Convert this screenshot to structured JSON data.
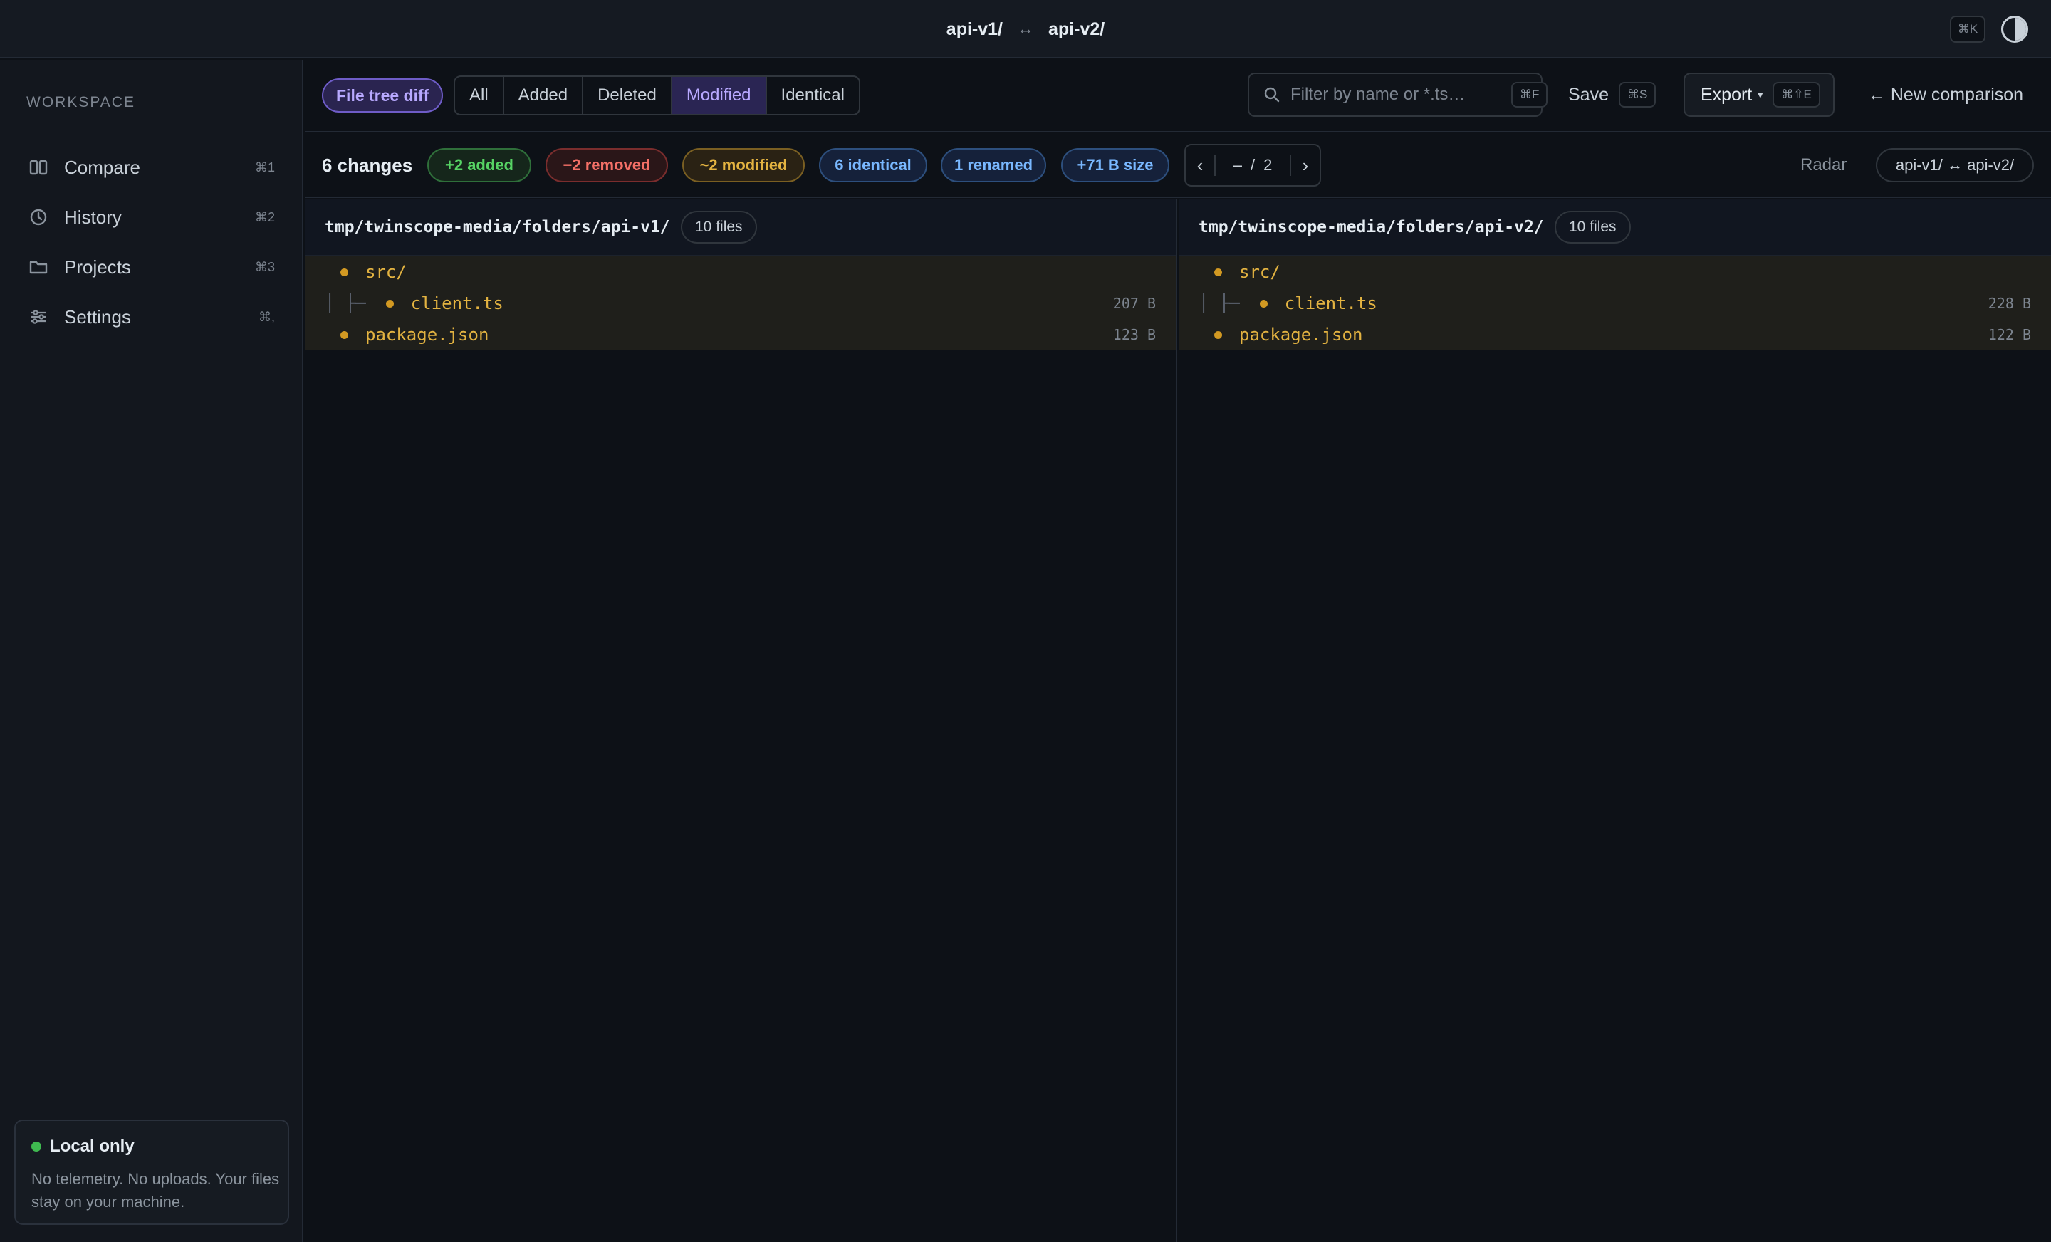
{
  "titlebar": {
    "left_name": "api-v1/",
    "arrow": "↔",
    "right_name": "api-v2/",
    "shortcut": "⌘K"
  },
  "sidebar": {
    "section_label": "WORKSPACE",
    "items": [
      {
        "label": "Compare",
        "shortcut": "⌘1",
        "icon": "columns-icon"
      },
      {
        "label": "History",
        "shortcut": "⌘2",
        "icon": "clock-icon"
      },
      {
        "label": "Projects",
        "shortcut": "⌘3",
        "icon": "folder-icon"
      },
      {
        "label": "Settings",
        "shortcut": "⌘,",
        "icon": "sliders-icon"
      }
    ],
    "privacy": {
      "title": "Local only",
      "text": "No telemetry. No uploads. Your files stay on your machine."
    }
  },
  "toolbar": {
    "view_pill": "File tree diff",
    "filters": [
      {
        "label": "All",
        "active": false
      },
      {
        "label": "Added",
        "active": false
      },
      {
        "label": "Deleted",
        "active": false
      },
      {
        "label": "Modified",
        "active": true
      },
      {
        "label": "Identical",
        "active": false
      }
    ],
    "search": {
      "placeholder": "Filter by name or *.ts…",
      "value": "",
      "shortcut": "⌘F"
    },
    "save": {
      "label": "Save",
      "shortcut": "⌘S"
    },
    "export": {
      "label": "Export",
      "caret": "▾",
      "shortcut": "⌘⇧E"
    },
    "new_comparison": "← New comparison"
  },
  "summary": {
    "changes": "6 changes",
    "added": "+2 added",
    "removed": "−2 removed",
    "modified": "~2 modified",
    "identical": "6 identical",
    "renamed": "1 renamed",
    "size": "+71 B size",
    "pager": {
      "prev": "‹",
      "current": "–",
      "sep": "/",
      "total": "2",
      "next": "›"
    },
    "radar": "Radar",
    "pair": "api-v1/ ↔ api-v2/"
  },
  "left": {
    "path": "tmp/twinscope-media/folders/api-v1/",
    "count": "10 files",
    "rows": [
      {
        "name": "src/",
        "size": ""
      },
      {
        "guide": "│  ├─",
        "name": "client.ts",
        "size": "207 B"
      },
      {
        "name": "package.json",
        "size": "123 B"
      }
    ]
  },
  "right": {
    "path": "tmp/twinscope-media/folders/api-v2/",
    "count": "10 files",
    "rows": [
      {
        "name": "src/",
        "size": ""
      },
      {
        "guide": "│  ├─",
        "name": "client.ts",
        "size": "228 B"
      },
      {
        "name": "package.json",
        "size": "122 B"
      }
    ]
  },
  "colors": {
    "accent": "#b8a9ff",
    "added": "#56d364",
    "removed": "#f47067",
    "modified": "#e3b341",
    "info": "#79b8ff"
  }
}
